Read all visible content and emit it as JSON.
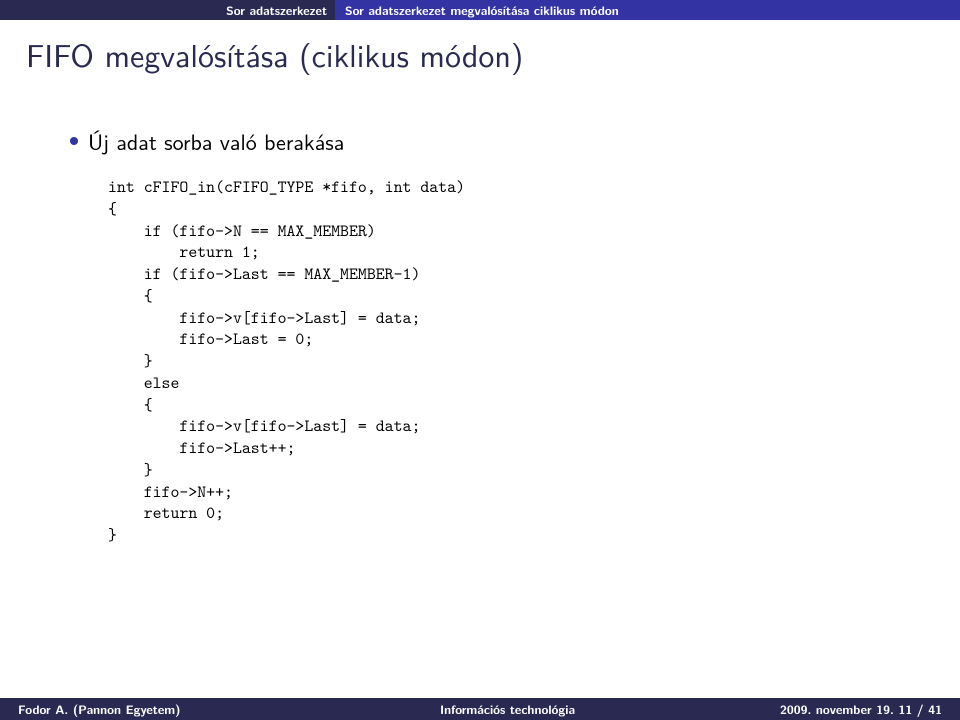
{
  "topbar": {
    "left": "Sor adatszerkezet",
    "right": "Sor adatszerkezet megvalósítása ciklikus módon"
  },
  "title": "FIFO megvalósítása (ciklikus módon)",
  "bullet": "Új adat sorba való berakása",
  "code": "int cFIFO_in(cFIFO_TYPE *fifo, int data)\n{\n    if (fifo->N == MAX_MEMBER)\n        return 1;\n    if (fifo->Last == MAX_MEMBER-1)\n    {\n        fifo->v[fifo->Last] = data;\n        fifo->Last = 0;\n    }\n    else\n    {\n        fifo->v[fifo->Last] = data;\n        fifo->Last++;\n    }\n    fifo->N++;\n    return 0;\n}",
  "footer": {
    "author": "Fodor A. (Pannon Egyetem)",
    "title": "Információs technológia",
    "date_page": "2009. november 19.      11 / 41"
  }
}
